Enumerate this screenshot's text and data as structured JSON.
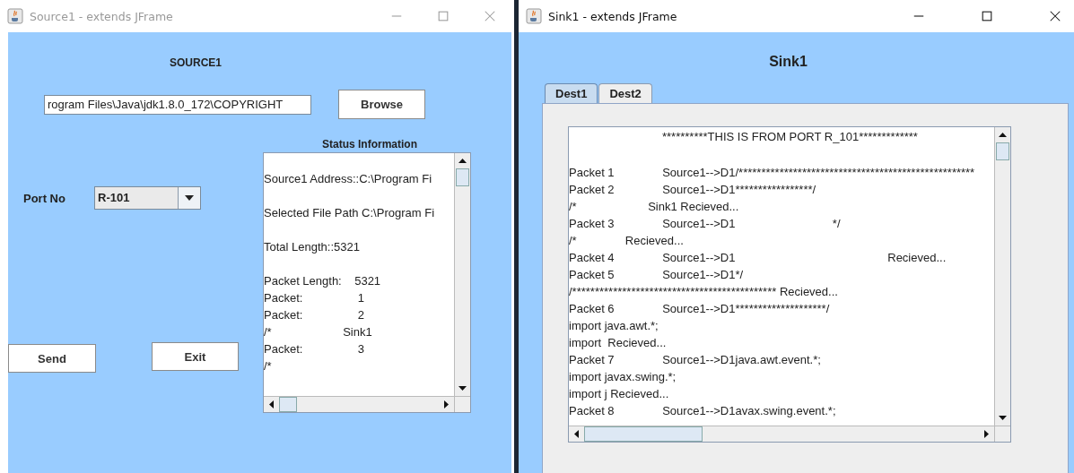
{
  "source_window": {
    "title": "Source1 - extends JFrame",
    "active": false,
    "heading": "SOURCE1",
    "file_field": {
      "value": "rogram Files\\Java\\jdk1.8.0_172\\COPYRIGHT"
    },
    "browse_button": "Browse",
    "port_label": "Port No",
    "port_combo": {
      "value": "R-101"
    },
    "status_label": "Status Information",
    "status_lines": [
      {
        "text": "Source1 Address::C:\\Program Fi",
        "blank_after": true
      },
      {
        "text": "Selected File Path C:\\Program Fi",
        "blank_after": true
      },
      {
        "text": "Total Length::5321",
        "blank_after": true
      },
      {
        "text": "Packet Length:    5321",
        "blank_after": false
      },
      {
        "text": "Packet:                 1",
        "blank_after": false
      },
      {
        "text": "Packet:                 2",
        "blank_after": false
      },
      {
        "text": "/*                      Sink1",
        "blank_after": false
      },
      {
        "text": "Packet:                 3",
        "blank_after": false
      },
      {
        "text": "/*",
        "blank_after": false
      }
    ],
    "send_button": "Send",
    "exit_button": "Exit"
  },
  "sink_window": {
    "title": "Sink1 - extends JFrame",
    "active": true,
    "heading": "Sink1",
    "tabs": [
      {
        "label": "Dest1",
        "selected": true
      },
      {
        "label": "Dest2",
        "selected": false
      }
    ],
    "output_lines": [
      {
        "kind": "header",
        "text": "**********THIS IS FROM PORT R_101*************",
        "blank_after": true
      },
      {
        "kind": "packet",
        "label": "Packet 1",
        "text": "Source1-->D1/****************************************************",
        "blank_after": false
      },
      {
        "kind": "packet",
        "label": "Packet 2",
        "text": "Source1-->D1*****************/",
        "blank_after": false
      },
      {
        "kind": "plain",
        "text": "/*                      Sink1 Recieved...",
        "blank_after": false
      },
      {
        "kind": "packet",
        "label": "Packet 3",
        "text": "Source1-->D1                              */",
        "blank_after": false
      },
      {
        "kind": "plain",
        "text": "/*               Recieved...",
        "blank_after": false
      },
      {
        "kind": "packet",
        "label": "Packet 4",
        "text": "Source1-->D1                                               Recieved...",
        "blank_after": false
      },
      {
        "kind": "packet",
        "label": "Packet 5",
        "text": "Source1-->D1*/",
        "blank_after": false
      },
      {
        "kind": "plain",
        "text": "/********************************************* Recieved...",
        "blank_after": false
      },
      {
        "kind": "packet",
        "label": "Packet 6",
        "text": "Source1-->D1********************/",
        "blank_after": false
      },
      {
        "kind": "plain",
        "text": "import java.awt.*;",
        "blank_after": false
      },
      {
        "kind": "plain",
        "text": "import  Recieved...",
        "blank_after": false
      },
      {
        "kind": "packet",
        "label": "Packet 7",
        "text": "Source1-->D1java.awt.event.*;",
        "blank_after": false
      },
      {
        "kind": "plain",
        "text": "import javax.swing.*;",
        "blank_after": false
      },
      {
        "kind": "plain",
        "text": "import j Recieved...",
        "blank_after": false
      },
      {
        "kind": "packet",
        "label": "Packet 8",
        "text": "Source1-->D1avax.swing.event.*;",
        "blank_after": false
      }
    ]
  }
}
